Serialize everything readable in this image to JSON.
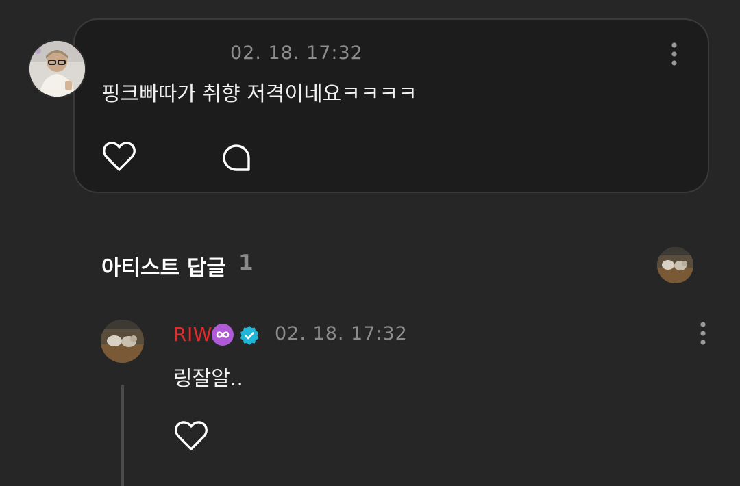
{
  "fan_comment": {
    "avatar_icon": "user-photo-avatar",
    "timestamp": "02. 18. 17:32",
    "text": "핑크빠따가 취향 저격이네요ㅋㅋㅋㅋ",
    "more_icon": "kebab-menu-icon",
    "like_icon": "heart-outline-icon",
    "reply_icon": "speech-bubble-icon"
  },
  "artist_replies": {
    "title": "아티스트 답글",
    "count": "1",
    "preview_avatar_icon": "artist-photo-avatar"
  },
  "reply": {
    "author": "RIW",
    "author_color": "#e02c2c",
    "badge_icon": "infinity-badge-icon",
    "badge_color": "#b05ad8",
    "verified_icon": "verified-check-icon",
    "verified_color": "#1fb6d8",
    "timestamp": "02. 18. 17:32",
    "text": "링잘알..",
    "more_icon": "kebab-menu-icon",
    "like_icon": "heart-outline-icon"
  },
  "colors": {
    "background": "#262626",
    "card_background": "#1c1c1d",
    "muted_text": "#8c8c8c"
  }
}
